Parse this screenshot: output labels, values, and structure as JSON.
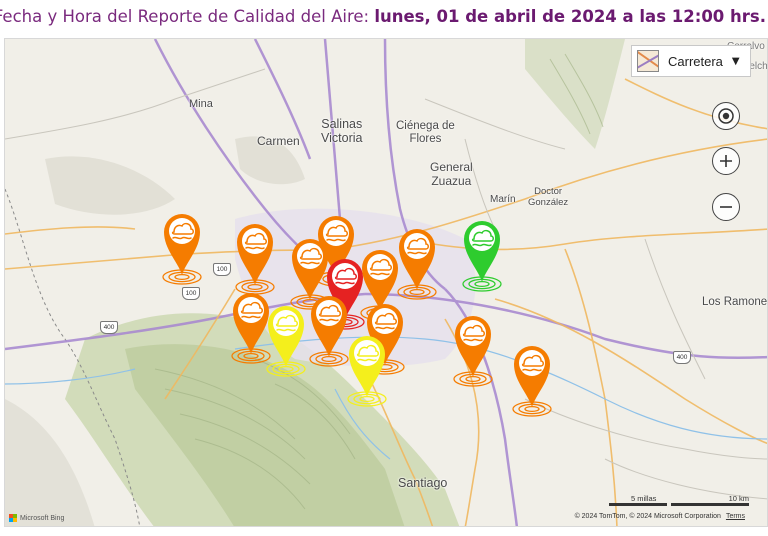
{
  "header": {
    "prefix": "Fecha y Hora del Reporte de Calidad del Aire: ",
    "datetime": "lunes, 01 de abril de 2024 a las 12:00 hrs."
  },
  "map": {
    "style_selector": {
      "label": "Carretera",
      "caret": "▼"
    },
    "controls": {
      "locate_icon": "locate-icon",
      "zoom_in_icon": "plus-icon",
      "zoom_out_icon": "minus-icon"
    },
    "places": [
      {
        "name": "Mina"
      },
      {
        "name": "Carmen"
      },
      {
        "name": "Salinas\nVictoria"
      },
      {
        "name": "Ciénega de\nFlores"
      },
      {
        "name": "General\nZuazua"
      },
      {
        "name": "Marín"
      },
      {
        "name": "Doctor\nGonzález"
      },
      {
        "name": "Los Ramones"
      },
      {
        "name": "Santiago"
      },
      {
        "name": "Cerralvo"
      },
      {
        "name": "Melchor"
      }
    ],
    "highway_shields": [
      "100",
      "100",
      "400",
      "400"
    ],
    "stations": [
      {
        "status": "orange",
        "color": "#f57c00"
      },
      {
        "status": "orange",
        "color": "#f57c00"
      },
      {
        "status": "orange",
        "color": "#f57c00"
      },
      {
        "status": "orange",
        "color": "#f57c00"
      },
      {
        "status": "red",
        "color": "#e52222"
      },
      {
        "status": "orange",
        "color": "#f57c00"
      },
      {
        "status": "orange",
        "color": "#f57c00"
      },
      {
        "status": "green",
        "color": "#2ecc2e"
      },
      {
        "status": "orange",
        "color": "#f57c00"
      },
      {
        "status": "yellow",
        "color": "#f4ef1c"
      },
      {
        "status": "orange",
        "color": "#f57c00"
      },
      {
        "status": "orange",
        "color": "#f57c00"
      },
      {
        "status": "yellow",
        "color": "#f4ef1c"
      },
      {
        "status": "orange",
        "color": "#f57c00"
      },
      {
        "status": "orange",
        "color": "#f57c00"
      }
    ],
    "scale": {
      "miles": "5 millas",
      "km": "10 km"
    },
    "attribution": {
      "text": "© 2024 TomTom, © 2024 Microsoft Corporation",
      "terms": "Terms"
    },
    "logo": "Microsoft Bing"
  }
}
